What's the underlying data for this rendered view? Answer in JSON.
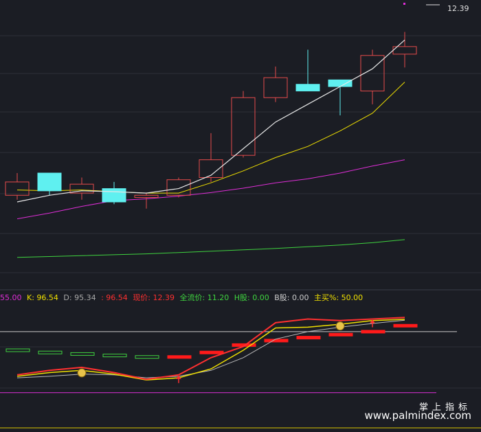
{
  "legend": {
    "v1": "55.00",
    "k_label": "K:",
    "k_value": "96.54",
    "d_label": "D:",
    "d_value": "95.34",
    "j_text": ": 96.54",
    "price_label": "现价:",
    "price_value": "12.39",
    "float_label": "全流价:",
    "float_value": "11.20",
    "h_label": "H股:",
    "h_value": "0.00",
    "b_label": "B股:",
    "b_value": "0.00",
    "main_label": "主买%:",
    "main_value": "50.00"
  },
  "last_price": "12.39",
  "watermark": {
    "cn": "掌上指标",
    "url": "www.palmindex.com"
  },
  "colors": {
    "bg": "#1b1d24",
    "up": "#e64b4b",
    "down": "#5ff0f0",
    "ma_white": "#e8e8e8",
    "ma_yellow": "#f0e000",
    "ma_magenta": "#e02ed8",
    "ma_green": "#3fd43f",
    "k": "#f0e000",
    "d": "#bbbbbb",
    "j": "#ff3030"
  },
  "chart_data": {
    "type": "candlestick",
    "candles": [
      {
        "o": 9.7,
        "c": 10.0,
        "h": 10.2,
        "l": 9.6
      },
      {
        "o": 10.2,
        "c": 9.8,
        "h": 10.2,
        "l": 9.7
      },
      {
        "o": 9.75,
        "c": 9.95,
        "h": 10.1,
        "l": 9.6
      },
      {
        "o": 9.85,
        "c": 9.55,
        "h": 10.0,
        "l": 9.5
      },
      {
        "o": 9.65,
        "c": 9.7,
        "h": 9.75,
        "l": 9.4
      },
      {
        "o": 9.7,
        "c": 10.05,
        "h": 10.1,
        "l": 9.65
      },
      {
        "o": 10.1,
        "c": 10.5,
        "h": 11.1,
        "l": 10.0
      },
      {
        "o": 10.6,
        "c": 11.9,
        "h": 12.05,
        "l": 10.55
      },
      {
        "o": 11.9,
        "c": 12.35,
        "h": 12.6,
        "l": 11.8
      },
      {
        "o": 12.2,
        "c": 12.05,
        "h": 12.98,
        "l": 12.05
      },
      {
        "o": 12.3,
        "c": 12.15,
        "h": 12.3,
        "l": 11.5
      },
      {
        "o": 12.05,
        "c": 12.85,
        "h": 12.98,
        "l": 11.75
      },
      {
        "o": 12.88,
        "c": 13.05,
        "h": 13.38,
        "l": 12.58
      }
    ],
    "ma_white": [
      9.55,
      9.7,
      9.8,
      9.78,
      9.75,
      9.85,
      10.15,
      10.75,
      11.35,
      11.75,
      12.15,
      12.55,
      13.2
    ],
    "ma_yellow": [
      9.82,
      9.8,
      9.82,
      9.78,
      9.75,
      9.75,
      9.98,
      10.25,
      10.55,
      10.8,
      11.15,
      11.55,
      12.25
    ],
    "ma_magenta": [
      9.17,
      9.3,
      9.45,
      9.58,
      9.62,
      9.68,
      9.76,
      9.86,
      9.98,
      10.07,
      10.2,
      10.36,
      10.5
    ],
    "ma_green": [
      8.3,
      8.32,
      8.34,
      8.36,
      8.38,
      8.41,
      8.44,
      8.47,
      8.5,
      8.54,
      8.58,
      8.63,
      8.7
    ],
    "j_series": [
      22,
      28,
      32,
      25,
      16,
      22,
      45,
      60,
      92,
      97,
      95,
      97,
      99
    ],
    "k_series": [
      20,
      25,
      28,
      23,
      15,
      18,
      30,
      55,
      85,
      86,
      90,
      95,
      96.5
    ],
    "d_series": [
      18,
      20,
      23,
      22,
      18,
      20,
      28,
      45,
      70,
      80,
      86,
      91,
      95.3
    ],
    "v_bars": [
      55,
      52,
      50,
      48,
      46,
      46,
      52,
      62,
      68,
      72,
      76,
      80,
      88
    ],
    "ylim_price": [
      7.6,
      14.1
    ],
    "ylim_kdj": [
      -5,
      115
    ]
  }
}
